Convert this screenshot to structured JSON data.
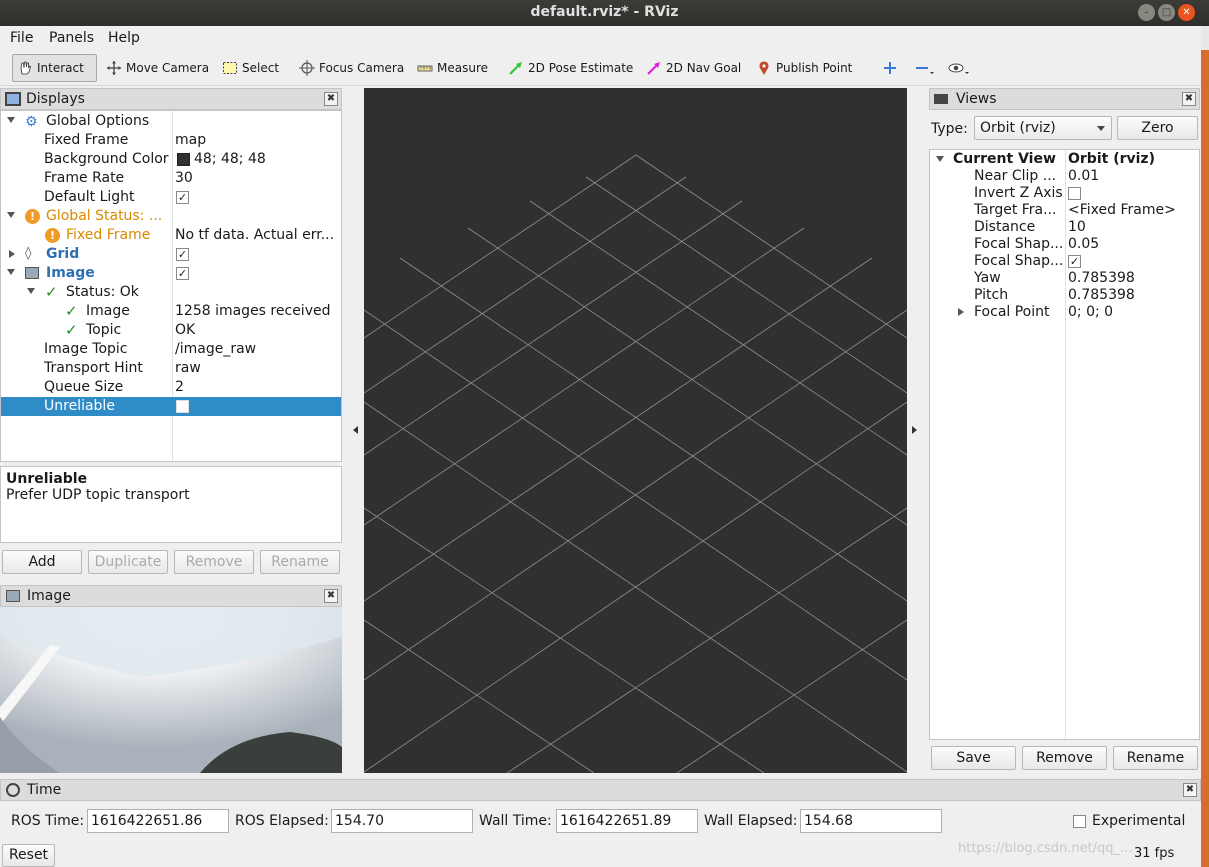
{
  "window": {
    "title": "default.rviz* - RViz"
  },
  "menu": {
    "file": "File",
    "panels": "Panels",
    "help": "Help"
  },
  "toolbar": {
    "interact": "Interact",
    "move_camera": "Move Camera",
    "select": "Select",
    "focus_camera": "Focus Camera",
    "measure": "Measure",
    "pose_estimate": "2D Pose Estimate",
    "nav_goal": "2D Nav Goal",
    "publish_point": "Publish Point"
  },
  "displays": {
    "title": "Displays",
    "rows": {
      "global_options": "Global Options",
      "fixed_frame": "Fixed Frame",
      "fixed_frame_val": "map",
      "bg_color": "Background Color",
      "bg_color_val": "48; 48; 48",
      "frame_rate": "Frame Rate",
      "frame_rate_val": "30",
      "default_light": "Default Light",
      "global_status": "Global Status: ...",
      "status_fixed_frame": "Fixed Frame",
      "status_fixed_frame_val": "No tf data.  Actual err...",
      "grid": "Grid",
      "image": "Image",
      "status_ok": "Status: Ok",
      "status_image": "Image",
      "status_image_val": "1258 images received",
      "status_topic": "Topic",
      "status_topic_val": "OK",
      "image_topic": "Image Topic",
      "image_topic_val": "/image_raw",
      "transport_hint": "Transport Hint",
      "transport_hint_val": "raw",
      "queue_size": "Queue Size",
      "queue_size_val": "2",
      "unreliable": "Unreliable"
    },
    "description": {
      "heading": "Unreliable",
      "text": "Prefer UDP topic transport"
    },
    "buttons": {
      "add": "Add",
      "duplicate": "Duplicate",
      "remove": "Remove",
      "rename": "Rename"
    }
  },
  "image_panel": {
    "title": "Image"
  },
  "views": {
    "title": "Views",
    "type_label": "Type:",
    "type_value": "Orbit (rviz)",
    "zero": "Zero",
    "current_view": "Current View",
    "current_view_val": "Orbit (rviz)",
    "props": [
      {
        "name": "Near Clip ...",
        "value": "0.01"
      },
      {
        "name": "Invert Z Axis",
        "value": ""
      },
      {
        "name": "Target Fra...",
        "value": "<Fixed Frame>"
      },
      {
        "name": "Distance",
        "value": "10"
      },
      {
        "name": "Focal Shap...",
        "value": "0.05"
      },
      {
        "name": "Focal Shap...",
        "value": ""
      },
      {
        "name": "Yaw",
        "value": "0.785398"
      },
      {
        "name": "Pitch",
        "value": "0.785398"
      },
      {
        "name": "Focal Point",
        "value": "0; 0; 0"
      }
    ],
    "buttons": {
      "save": "Save",
      "remove": "Remove",
      "rename": "Rename"
    }
  },
  "time": {
    "title": "Time",
    "ros_time_label": "ROS Time:",
    "ros_time": "1616422651.86",
    "ros_elapsed_label": "ROS Elapsed:",
    "ros_elapsed": "154.70",
    "wall_time_label": "Wall Time:",
    "wall_time": "1616422651.89",
    "wall_elapsed_label": "Wall Elapsed:",
    "wall_elapsed": "154.68",
    "experimental": "Experimental",
    "reset": "Reset",
    "fps": "31 fps"
  },
  "watermark": "https://blog.csdn.net/qq_...",
  "colors": {
    "background": "#303030",
    "selection": "#308cc6",
    "titlebar": "#3c3b37",
    "close": "#e9541f"
  }
}
